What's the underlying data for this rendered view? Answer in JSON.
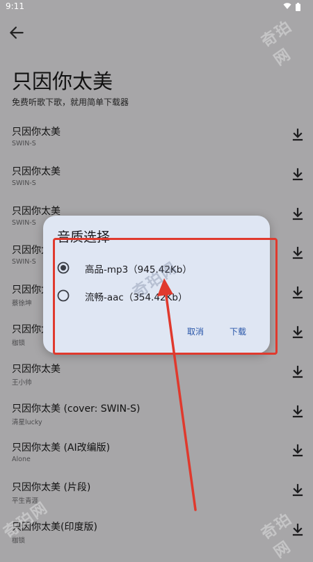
{
  "status_bar": {
    "time": "9:11"
  },
  "header": {
    "title": "只因你太美",
    "subtitle": "免费听歌下歌，就用简单下载器"
  },
  "songs": [
    {
      "title": "只因你太美",
      "artist": "SWIN-S"
    },
    {
      "title": "只因你太美",
      "artist": "SWIN-S"
    },
    {
      "title": "只因你太美",
      "artist": "SWIN-S"
    },
    {
      "title": "只因你太美",
      "artist": "SWIN-S"
    },
    {
      "title": "只因你太美",
      "artist": "蔡徐坤"
    },
    {
      "title": "只因你太美",
      "artist": "枷锁"
    },
    {
      "title": "只因你太美",
      "artist": "王小帅"
    },
    {
      "title": "只因你太美 (cover: SWIN-S)",
      "artist": "清星lucky"
    },
    {
      "title": "只因你太美 (AI改编版)",
      "artist": "Alone"
    },
    {
      "title": "只因你太美 (片段)",
      "artist": "平生青涯"
    },
    {
      "title": "只因你太美(印度版)",
      "artist": "枷锁"
    }
  ],
  "dialog": {
    "title": "音质选择",
    "options": [
      {
        "label": "高品-mp3（945.42Kb）",
        "selected": true
      },
      {
        "label": "流畅-aac（354.42Kb）",
        "selected": false
      }
    ],
    "cancel_label": "取消",
    "download_label": "下载"
  },
  "watermark": "奇珀网",
  "colors": {
    "accent": "#2855a8",
    "annotation": "#e0392d",
    "dialog_bg": "#dfe6f3",
    "scrim_bg": "#a7a6a8"
  }
}
